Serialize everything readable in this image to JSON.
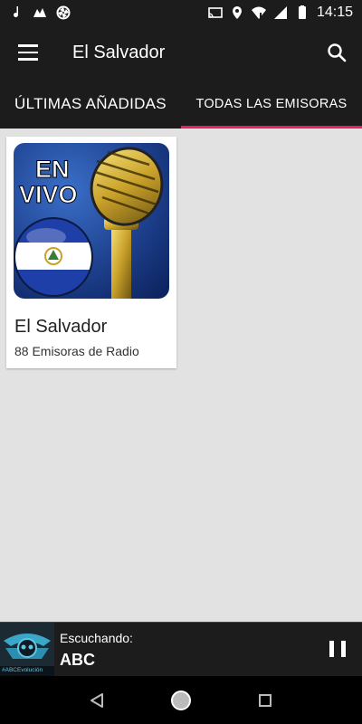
{
  "status_bar": {
    "time": "14:15",
    "left_icons": [
      "music-note-icon",
      "cap-icon",
      "aperture-icon"
    ],
    "right_icons": [
      "cast-icon",
      "location-icon",
      "wifi-icon",
      "signal-icon",
      "battery-icon"
    ]
  },
  "app_bar": {
    "title": "El Salvador"
  },
  "tabs": [
    {
      "label": "ÚLTIMAS AÑADIDAS",
      "selected": false
    },
    {
      "label": "TODAS LAS EMISORAS",
      "selected": true
    }
  ],
  "colors": {
    "app_bar_bg": "#1c1c1c",
    "accent": "#e91e63",
    "content_bg": "#e2e2e2",
    "flag_blue": "#1e3ea8"
  },
  "cards": [
    {
      "title": "El Salvador",
      "subtitle": "88 Emisoras de Radio",
      "image_text": [
        "EN",
        "VIVO"
      ]
    }
  ],
  "player": {
    "label": "Escuchando:",
    "station": "ABC",
    "thumb_caption": "#ABCEvolución",
    "state": "playing"
  },
  "nav_bar": {
    "buttons": [
      "back-icon",
      "home-icon",
      "recents-icon"
    ]
  }
}
